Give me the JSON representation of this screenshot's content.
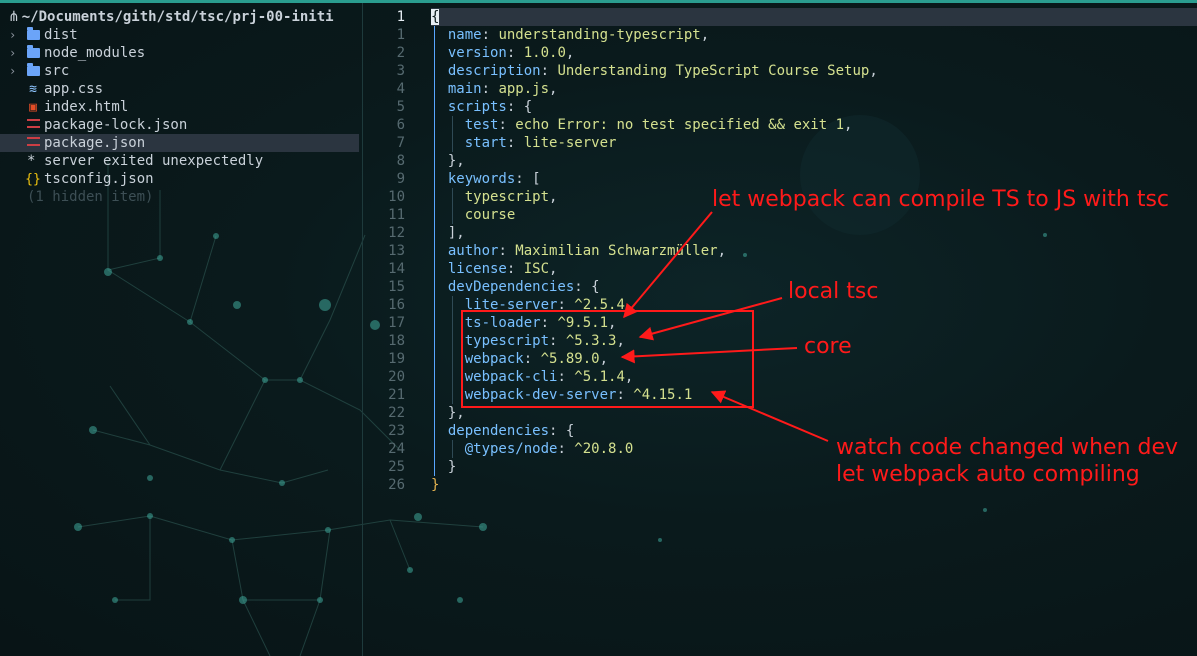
{
  "sidebar": {
    "header_icon": "folder-root-icon",
    "path": "~/Documents/gith/std/tsc/prj-00-initi",
    "items": [
      {
        "label": "dist",
        "icon": "folder-icon",
        "chevron": "›"
      },
      {
        "label": "node_modules",
        "icon": "folder-icon",
        "chevron": "›"
      },
      {
        "label": "src",
        "icon": "folder-icon",
        "chevron": "›"
      },
      {
        "label": "app.css",
        "icon": "css-file-icon"
      },
      {
        "label": "index.html",
        "icon": "html-file-icon"
      },
      {
        "label": "package-lock.json",
        "icon": "json-file-icon"
      },
      {
        "label": "package.json",
        "icon": "json-file-icon",
        "selected": true
      }
    ],
    "message": {
      "star": "*",
      "text": "server exited unexpectedly"
    },
    "tsconfig": {
      "label": "tsconfig.json",
      "icon": "braces-file-icon",
      "glyph": "{}"
    },
    "hidden_items": "(1 hidden item)"
  },
  "editor": {
    "current_line": 1,
    "lines": [
      {
        "n": "1",
        "parts": [
          {
            "t": "{",
            "c": "cursor"
          }
        ]
      },
      {
        "n": "1",
        "parts": [
          {
            "t": "  "
          },
          {
            "t": "name",
            "c": "k"
          },
          {
            "t": ": ",
            "c": "p"
          },
          {
            "t": "understanding-typescript",
            "c": "v"
          },
          {
            "t": ",",
            "c": "p"
          }
        ]
      },
      {
        "n": "2",
        "parts": [
          {
            "t": "  "
          },
          {
            "t": "version",
            "c": "k"
          },
          {
            "t": ": ",
            "c": "p"
          },
          {
            "t": "1.0.0",
            "c": "v"
          },
          {
            "t": ",",
            "c": "p"
          }
        ]
      },
      {
        "n": "3",
        "parts": [
          {
            "t": "  "
          },
          {
            "t": "description",
            "c": "k"
          },
          {
            "t": ": ",
            "c": "p"
          },
          {
            "t": "Understanding TypeScript Course Setup",
            "c": "v"
          },
          {
            "t": ",",
            "c": "p"
          }
        ]
      },
      {
        "n": "4",
        "parts": [
          {
            "t": "  "
          },
          {
            "t": "main",
            "c": "k"
          },
          {
            "t": ": ",
            "c": "p"
          },
          {
            "t": "app.js",
            "c": "v"
          },
          {
            "t": ",",
            "c": "p"
          }
        ]
      },
      {
        "n": "5",
        "parts": [
          {
            "t": "  "
          },
          {
            "t": "scripts",
            "c": "k"
          },
          {
            "t": ": ",
            "c": "p"
          },
          {
            "t": "{",
            "c": "p"
          }
        ]
      },
      {
        "n": "6",
        "parts": [
          {
            "t": "    "
          },
          {
            "t": "test",
            "c": "k"
          },
          {
            "t": ": ",
            "c": "p"
          },
          {
            "t": "echo Error: no test specified && exit 1",
            "c": "v"
          },
          {
            "t": ",",
            "c": "p"
          }
        ]
      },
      {
        "n": "7",
        "parts": [
          {
            "t": "    "
          },
          {
            "t": "start",
            "c": "k"
          },
          {
            "t": ": ",
            "c": "p"
          },
          {
            "t": "lite-server",
            "c": "v"
          }
        ]
      },
      {
        "n": "8",
        "parts": [
          {
            "t": "  "
          },
          {
            "t": "},",
            "c": "p"
          }
        ]
      },
      {
        "n": "9",
        "parts": [
          {
            "t": "  "
          },
          {
            "t": "keywords",
            "c": "k"
          },
          {
            "t": ": ",
            "c": "p"
          },
          {
            "t": "[",
            "c": "p"
          }
        ]
      },
      {
        "n": "10",
        "parts": [
          {
            "t": "    "
          },
          {
            "t": "typescript",
            "c": "v"
          },
          {
            "t": ",",
            "c": "p"
          }
        ]
      },
      {
        "n": "11",
        "parts": [
          {
            "t": "    "
          },
          {
            "t": "course",
            "c": "v"
          }
        ]
      },
      {
        "n": "12",
        "parts": [
          {
            "t": "  "
          },
          {
            "t": "],",
            "c": "p"
          }
        ]
      },
      {
        "n": "13",
        "parts": [
          {
            "t": "  "
          },
          {
            "t": "author",
            "c": "k"
          },
          {
            "t": ": ",
            "c": "p"
          },
          {
            "t": "Maximilian Schwarzmüller",
            "c": "v"
          },
          {
            "t": ",",
            "c": "p"
          }
        ]
      },
      {
        "n": "14",
        "parts": [
          {
            "t": "  "
          },
          {
            "t": "license",
            "c": "k"
          },
          {
            "t": ": ",
            "c": "p"
          },
          {
            "t": "ISC",
            "c": "v"
          },
          {
            "t": ",",
            "c": "p"
          }
        ]
      },
      {
        "n": "15",
        "parts": [
          {
            "t": "  "
          },
          {
            "t": "devDependencies",
            "c": "k"
          },
          {
            "t": ": ",
            "c": "p"
          },
          {
            "t": "{",
            "c": "p"
          }
        ]
      },
      {
        "n": "16",
        "parts": [
          {
            "t": "    "
          },
          {
            "t": "lite-server",
            "c": "k"
          },
          {
            "t": ": ",
            "c": "p"
          },
          {
            "t": "^2.5.4",
            "c": "v"
          },
          {
            "t": ",",
            "c": "p"
          }
        ]
      },
      {
        "n": "17",
        "parts": [
          {
            "t": "    "
          },
          {
            "t": "ts-loader",
            "c": "k"
          },
          {
            "t": ": ",
            "c": "p"
          },
          {
            "t": "^9.5.1",
            "c": "v"
          },
          {
            "t": ",",
            "c": "p"
          }
        ]
      },
      {
        "n": "18",
        "parts": [
          {
            "t": "    "
          },
          {
            "t": "typescript",
            "c": "k"
          },
          {
            "t": ": ",
            "c": "p"
          },
          {
            "t": "^5.3.3",
            "c": "v"
          },
          {
            "t": ",",
            "c": "p"
          }
        ]
      },
      {
        "n": "19",
        "parts": [
          {
            "t": "    "
          },
          {
            "t": "webpack",
            "c": "k"
          },
          {
            "t": ": ",
            "c": "p"
          },
          {
            "t": "^5.89.0",
            "c": "v"
          },
          {
            "t": ",",
            "c": "p"
          }
        ]
      },
      {
        "n": "20",
        "parts": [
          {
            "t": "    "
          },
          {
            "t": "webpack-cli",
            "c": "k"
          },
          {
            "t": ": ",
            "c": "p"
          },
          {
            "t": "^5.1.4",
            "c": "v"
          },
          {
            "t": ",",
            "c": "p"
          }
        ]
      },
      {
        "n": "21",
        "parts": [
          {
            "t": "    "
          },
          {
            "t": "webpack-dev-server",
            "c": "k"
          },
          {
            "t": ": ",
            "c": "p"
          },
          {
            "t": "^4.15.1",
            "c": "v"
          }
        ]
      },
      {
        "n": "22",
        "parts": [
          {
            "t": "  "
          },
          {
            "t": "},",
            "c": "p"
          }
        ]
      },
      {
        "n": "23",
        "parts": [
          {
            "t": "  "
          },
          {
            "t": "dependencies",
            "c": "k"
          },
          {
            "t": ": ",
            "c": "p"
          },
          {
            "t": "{",
            "c": "p"
          }
        ]
      },
      {
        "n": "24",
        "parts": [
          {
            "t": "    "
          },
          {
            "t": "@types/node",
            "c": "k"
          },
          {
            "t": ": ",
            "c": "p"
          },
          {
            "t": "^20.8.0",
            "c": "v"
          }
        ]
      },
      {
        "n": "25",
        "parts": [
          {
            "t": "  "
          },
          {
            "t": "}",
            "c": "p"
          }
        ]
      },
      {
        "n": "26",
        "parts": [
          {
            "t": "}",
            "c": "br"
          }
        ]
      }
    ]
  },
  "annotations": {
    "webpack_tsc": "let webpack can compile TS to JS with tsc",
    "local_tsc": "local tsc",
    "core": "core",
    "watch_line1": "watch code changed when dev",
    "watch_line2": "let webpack auto compiling",
    "color": "#ff1a1a"
  },
  "colors": {
    "key": "#79c0ff",
    "value": "#d4e08f",
    "accent": "#2a9d8f",
    "selection": "#2b3540"
  }
}
